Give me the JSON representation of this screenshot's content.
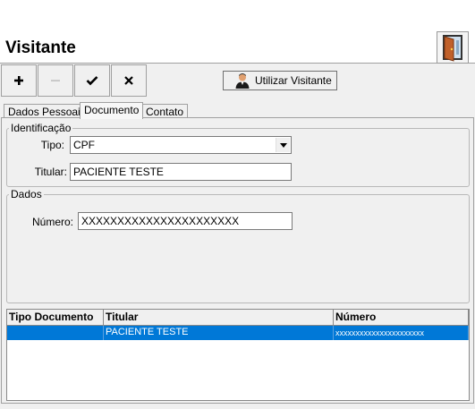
{
  "window": {
    "title": "Visitante"
  },
  "toolbar": {
    "add_label": "+",
    "remove_label": "−",
    "confirm_label": "✔",
    "cancel_label": "✕",
    "use_visitor_label": "Utilizar Visitante"
  },
  "tabs": [
    {
      "label": "Dados Pessoais"
    },
    {
      "label": "Documento"
    },
    {
      "label": "Contato"
    }
  ],
  "identificacao": {
    "legend": "Identificação",
    "tipo_label": "Tipo:",
    "tipo_value": "CPF",
    "titular_label": "Titular:",
    "titular_value": "PACIENTE TESTE"
  },
  "dados": {
    "legend": "Dados",
    "numero_label": "Número:",
    "numero_value": "XXXXXXXXXXXXXXXXXXXXXX"
  },
  "grid": {
    "columns": [
      "Tipo Documento",
      "Titular",
      "Número"
    ],
    "rows": [
      {
        "tipo": "",
        "titular": "PACIENTE TESTE",
        "numero": "xxxxxxxxxxxxxxxxxxxxxx"
      }
    ]
  },
  "colors": {
    "selection": "#0078d7",
    "window_bg": "#f0f0f0"
  },
  "icons": {
    "door": "door-exit-icon",
    "user": "user-icon"
  }
}
